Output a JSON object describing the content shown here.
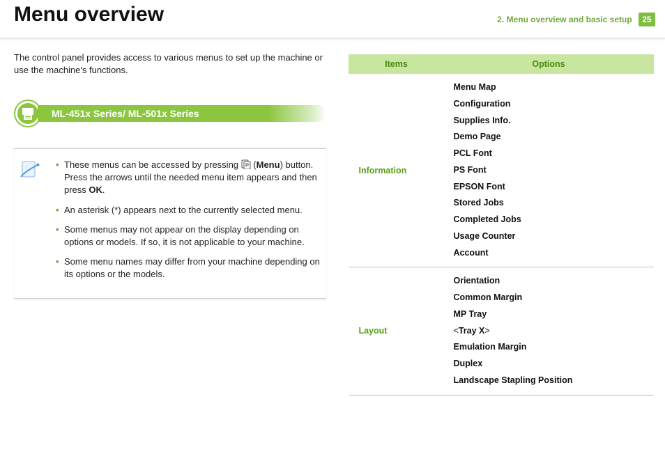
{
  "header": {
    "title": "Menu overview",
    "breadcrumb": "2.   Menu overview and basic setup",
    "page_number": "25"
  },
  "intro": "The control panel provides access to various menus to set up the machine or use the machine's functions.",
  "series_bar": "ML-451x Series/ ML-501x Series",
  "notes": {
    "n1a": "These menus can be accessed by pressing ",
    "n1b": " (",
    "n1c": "Menu",
    "n1d": ") button. Press the arrows until the needed menu item appears and then press ",
    "n1e": "OK",
    "n1f": ".",
    "n2": "An asterisk (*) appears next to the currently selected menu.",
    "n3": "Some menus may not appear on the display depending on options or models. If so, it is not applicable to your machine.",
    "n4": "Some menu names may differ from your machine depending on its options or the models."
  },
  "table": {
    "head_items": "Items",
    "head_options": "Options",
    "rows": [
      {
        "item": "Information",
        "options": [
          "Menu Map",
          "Configuration",
          "Supplies Info.",
          "Demo Page",
          "PCL Font",
          "PS Font",
          "EPSON Font",
          "Stored Jobs",
          "Completed Jobs",
          "Usage Counter",
          "Account"
        ]
      },
      {
        "item": "Layout",
        "options": [
          "Orientation",
          "Common Margin",
          "MP Tray",
          "<Tray X>",
          "Emulation Margin",
          "Duplex",
          "Landscape Stapling Position"
        ]
      }
    ]
  }
}
